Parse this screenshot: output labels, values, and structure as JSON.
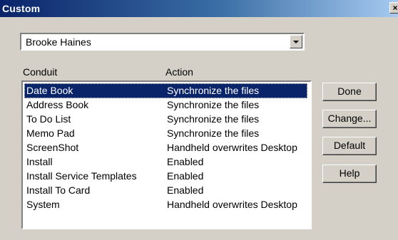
{
  "window": {
    "title": "Custom",
    "close_glyph": "×"
  },
  "user_select": {
    "value": "Brooke Haines"
  },
  "columns": {
    "conduit": "Conduit",
    "action": "Action"
  },
  "rows": [
    {
      "conduit": "Date Book",
      "action": "Synchronize the files",
      "selected": true
    },
    {
      "conduit": "Address Book",
      "action": "Synchronize the files",
      "selected": false
    },
    {
      "conduit": "To Do List",
      "action": "Synchronize the files",
      "selected": false
    },
    {
      "conduit": "Memo Pad",
      "action": "Synchronize the files",
      "selected": false
    },
    {
      "conduit": "ScreenShot",
      "action": "Handheld overwrites Desktop",
      "selected": false
    },
    {
      "conduit": "Install",
      "action": "Enabled",
      "selected": false
    },
    {
      "conduit": "Install Service Templates",
      "action": "Enabled",
      "selected": false
    },
    {
      "conduit": "Install To Card",
      "action": "Enabled",
      "selected": false
    },
    {
      "conduit": "System",
      "action": "Handheld overwrites Desktop",
      "selected": false
    }
  ],
  "buttons": {
    "done": "Done",
    "change": "Change...",
    "default": "Default",
    "help": "Help"
  },
  "colors": {
    "titlebar": "#0a246a",
    "selection": "#0a246a",
    "face": "#d4d0c8"
  },
  "icons": {
    "close": "close-icon",
    "dropdown": "chevron-down-icon"
  }
}
